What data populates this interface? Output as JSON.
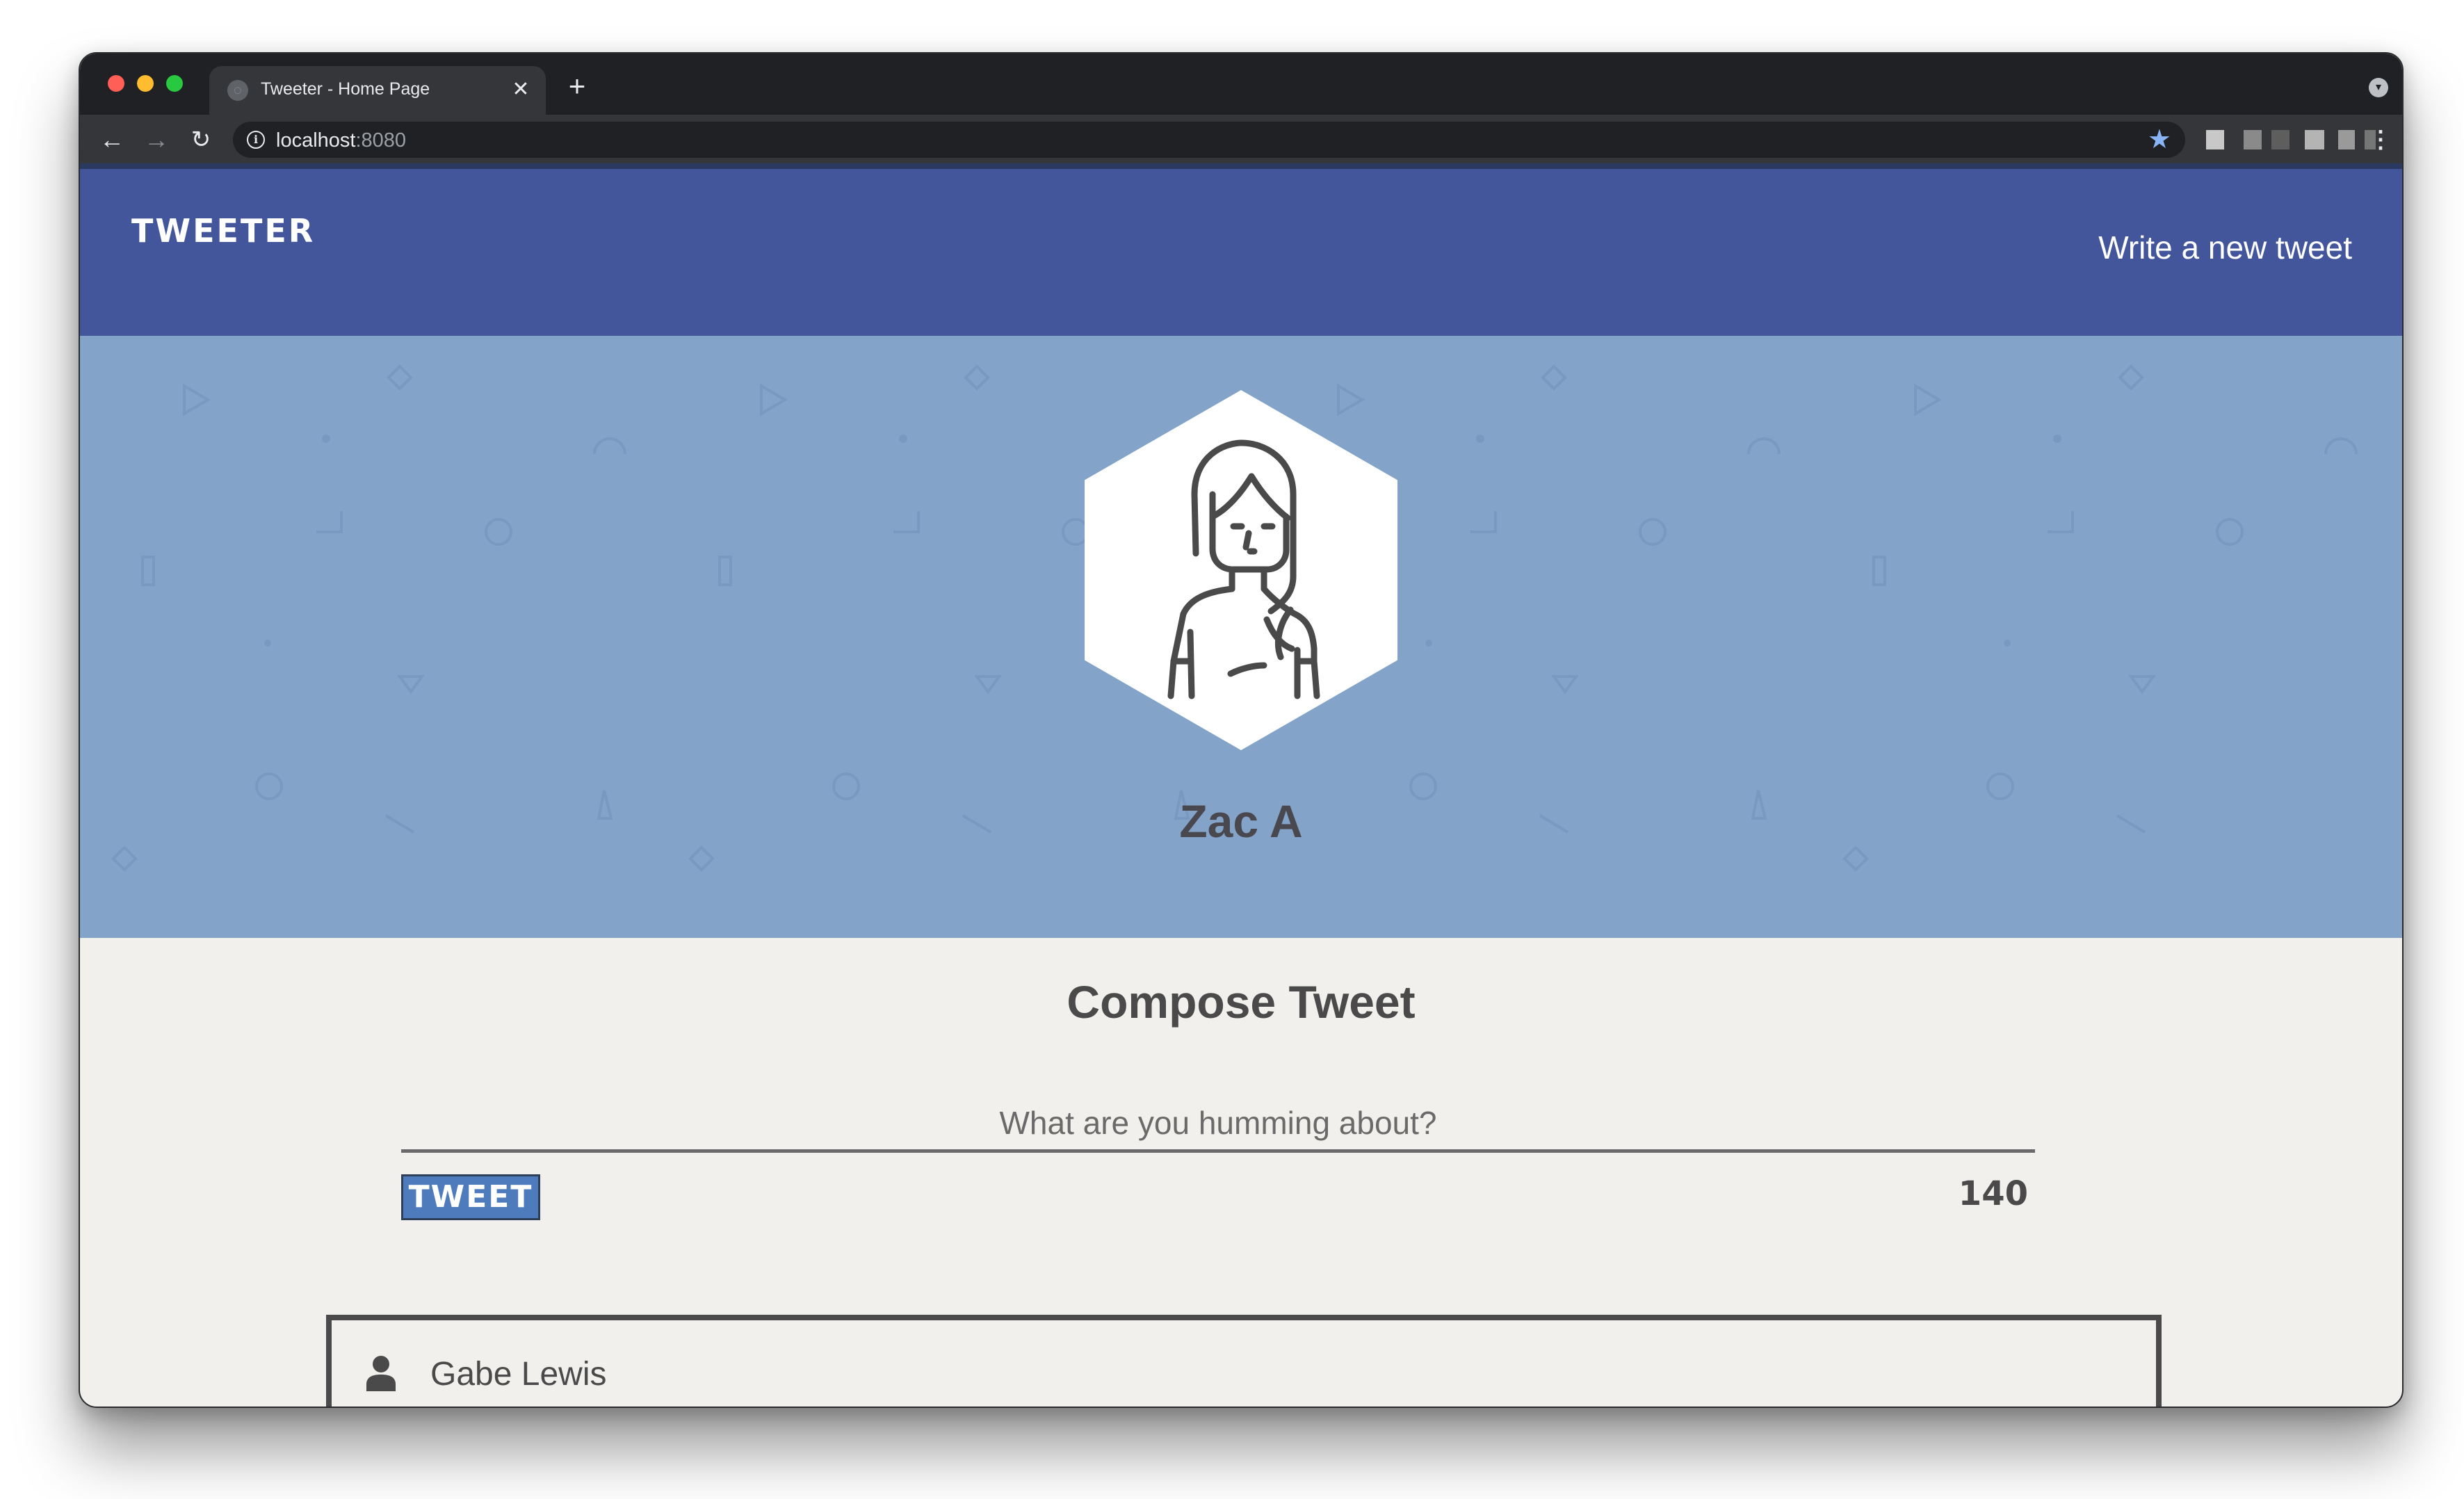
{
  "browser": {
    "tab": {
      "title": "Tweeter - Home Page",
      "close_glyph": "✕"
    },
    "new_tab_glyph": "+",
    "address": {
      "host": "localhost",
      "port": ":8080"
    },
    "icons": {
      "back": "←",
      "forward": "→",
      "reload": "↻",
      "info": "i",
      "star": "★",
      "menu": "⋮",
      "profile": "▾",
      "favicon": "◌"
    }
  },
  "app": {
    "logo": "TWEETER",
    "nav_link": "Write a new tweet"
  },
  "profile": {
    "name": "Zac A"
  },
  "compose": {
    "title": "Compose Tweet",
    "placeholder": "What are you humming about?",
    "button_label": "TWEET",
    "counter": "140"
  },
  "tweets": [
    {
      "user": "Gabe Lewis"
    }
  ],
  "colors": {
    "nav": "#43569c",
    "header": "#84a3c9",
    "page_bg": "#f2f0ec",
    "button": "#4e7bbb",
    "text": "#4a4a4a"
  }
}
